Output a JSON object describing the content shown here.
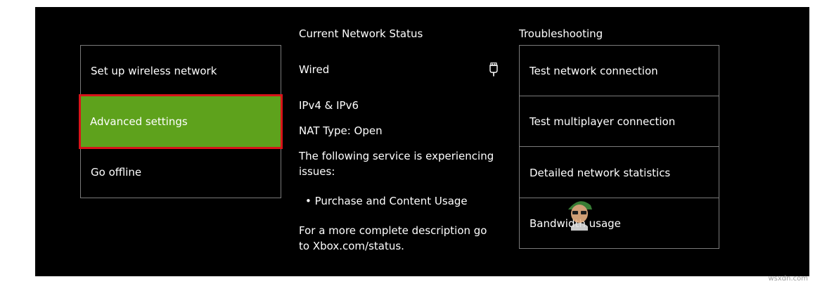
{
  "menu": {
    "items": [
      {
        "label": "Set up wireless network"
      },
      {
        "label": "Advanced settings"
      },
      {
        "label": "Go offline"
      }
    ],
    "selected": "Advanced settings"
  },
  "status": {
    "heading": "Current Network Status",
    "connection": "Wired",
    "protocol": "IPv4 & IPv6",
    "nat": "NAT Type: Open",
    "service_message": "The following service is experiencing issues:",
    "service_item": "• Purchase and Content Usage",
    "description": "For a more complete description go to Xbox.com/status."
  },
  "troubleshooting": {
    "heading": "Troubleshooting",
    "items": [
      {
        "label": "Test network connection"
      },
      {
        "label": "Test multiplayer connection"
      },
      {
        "label": "Detailed network statistics"
      },
      {
        "label": "Bandwidth usage"
      }
    ]
  },
  "icons": {
    "connection": "ethernet-plug-icon",
    "watermark": "appuals-mascot-icon"
  },
  "watermark_text": "wsxdn.com",
  "colors": {
    "background": "#000000",
    "selected": "#5ea21c",
    "focus": "#d8141a",
    "border": "#7a7a7a"
  }
}
